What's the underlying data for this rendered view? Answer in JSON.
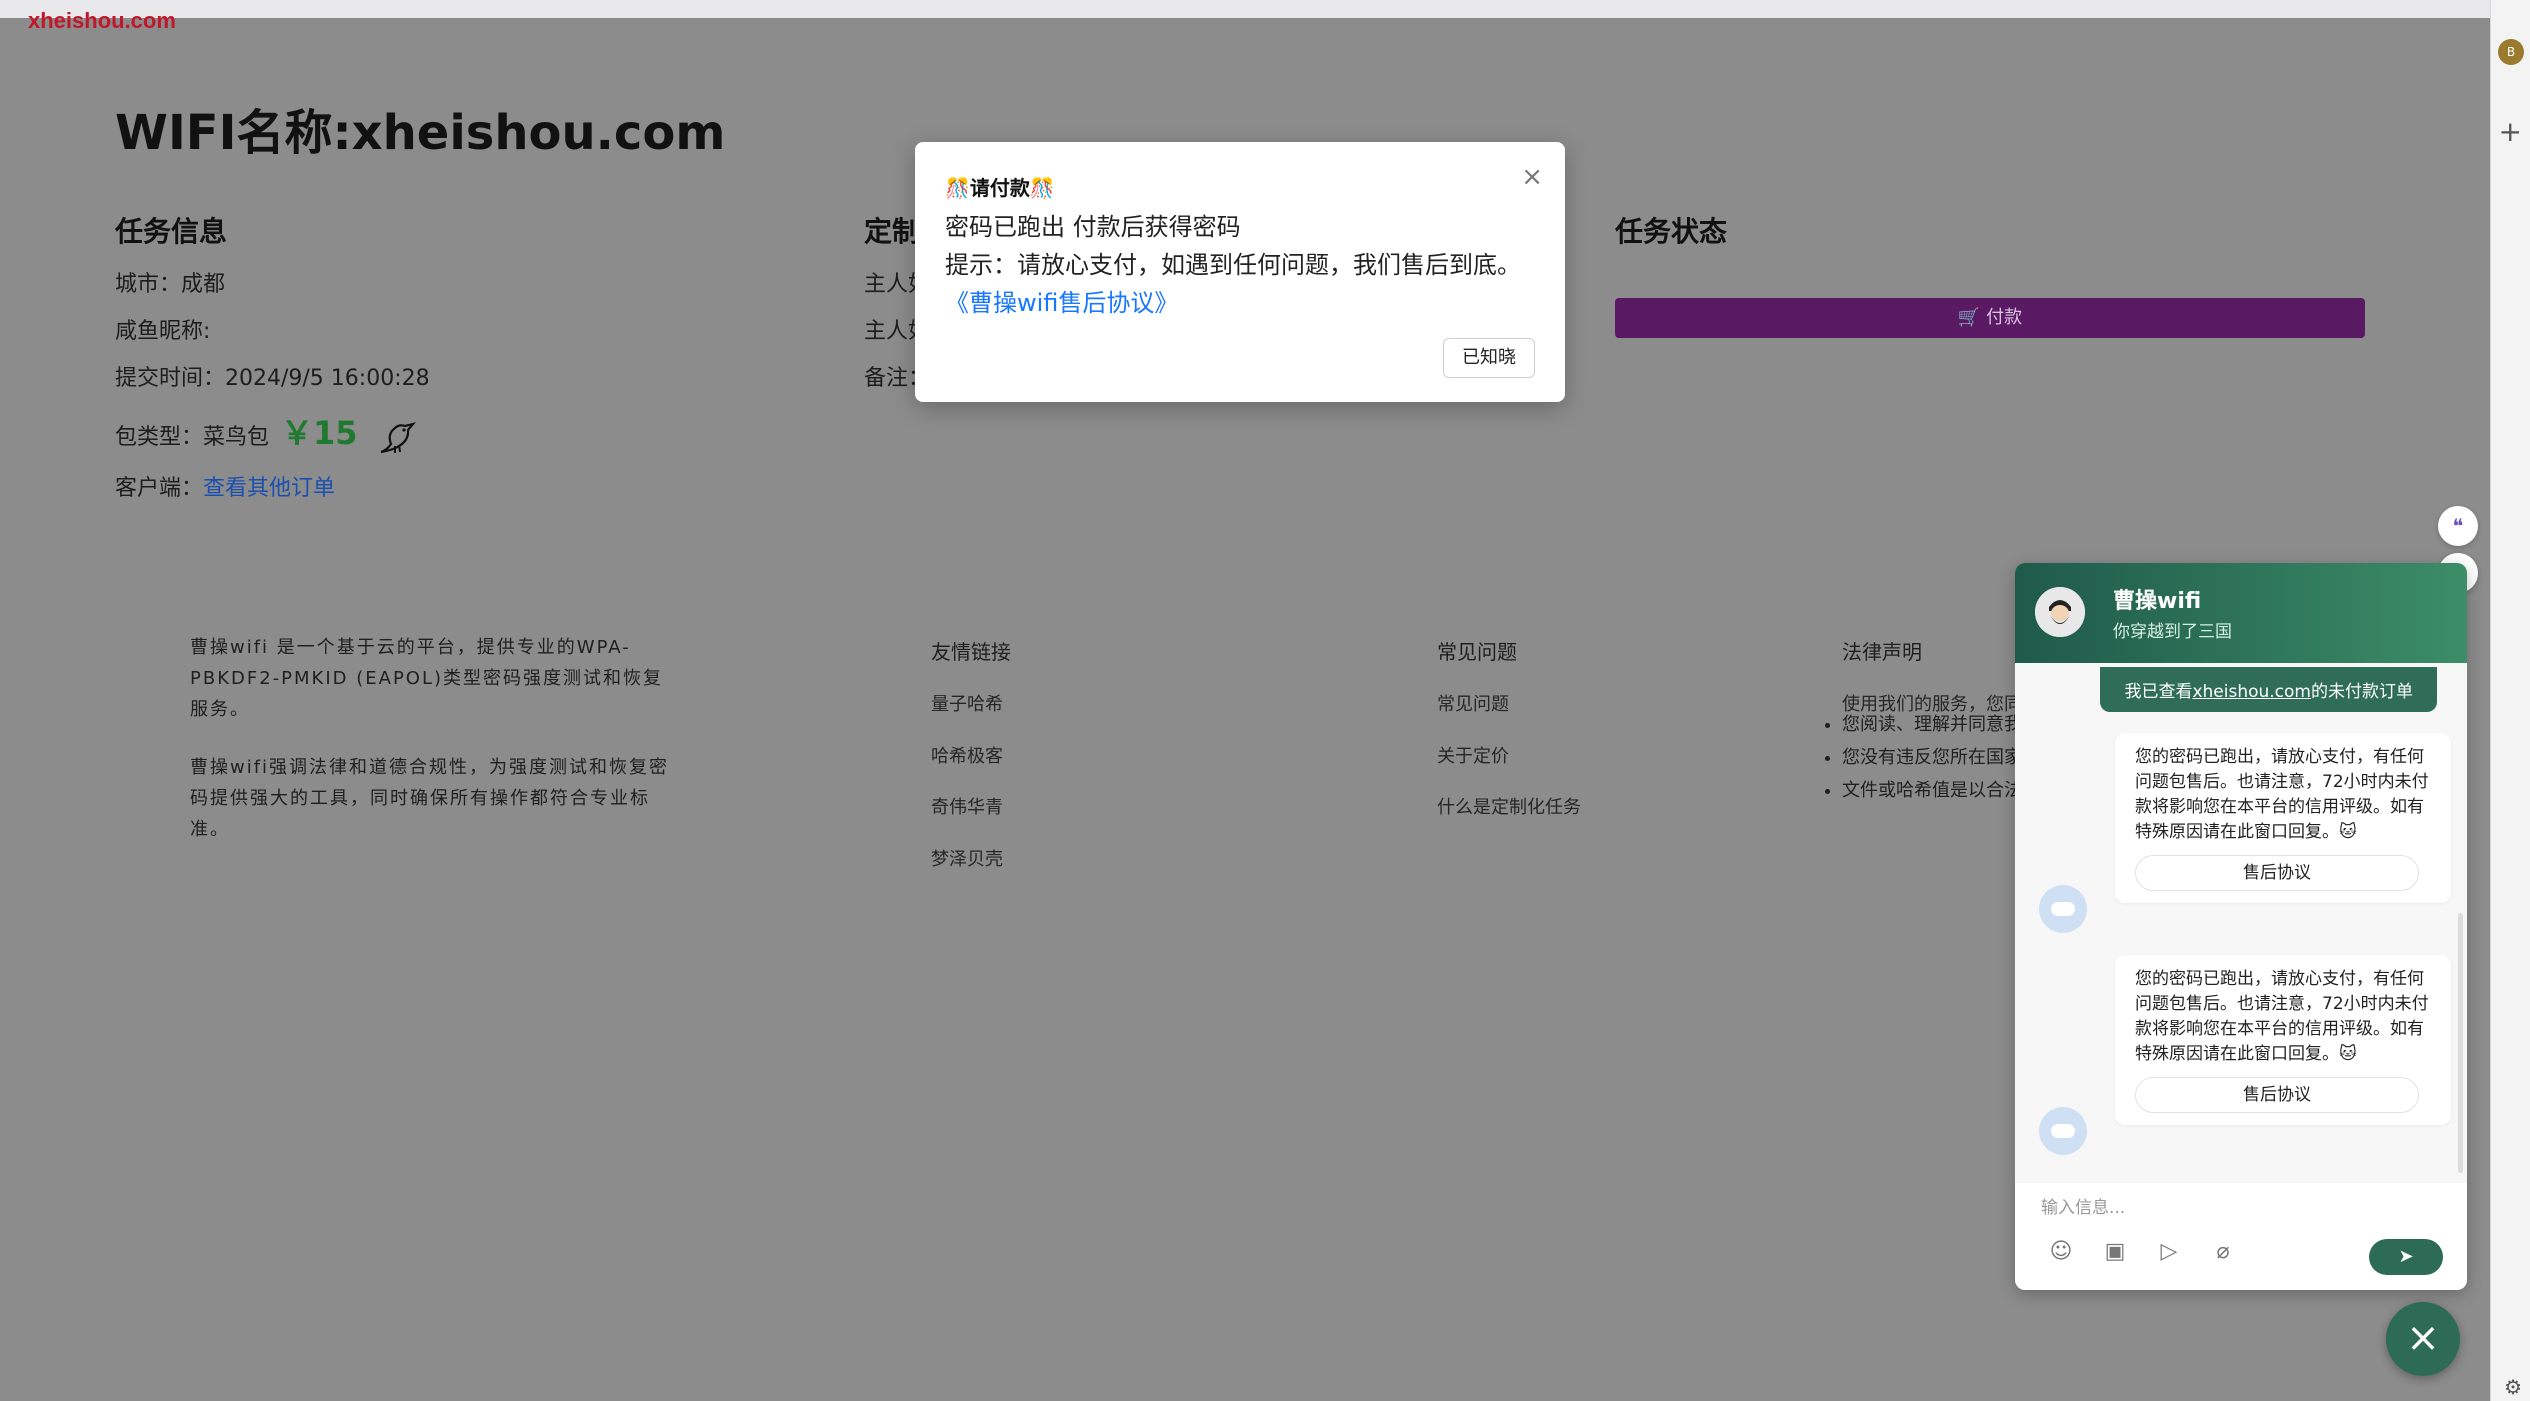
{
  "browser": {
    "brand": "xheishou.com",
    "avatar_letter": "B",
    "add_icon": "plus-icon",
    "settings_icon": "gear-icon"
  },
  "page": {
    "wifi_title": "WIFI名称:xheishou.com",
    "task_info": {
      "heading": "任务信息",
      "city": "城市：成都",
      "nickname": "咸鱼昵称:",
      "submit_time": "提交时间：2024/9/5 16:00:28",
      "package_label": "包类型：菜鸟包",
      "price": "￥15",
      "client_label": "客户端：",
      "client_link": "查看其他订单"
    },
    "custom": {
      "heading": "定制",
      "line1": "主人如",
      "line2": "主人如",
      "line3": "备注："
    },
    "task_status": {
      "heading": "任务状态",
      "pay_label": "付款"
    }
  },
  "footer": {
    "about_p1": "曹操wifi 是一个基于云的平台，提供专业的WPA-PBKDF2-PMKID (EAPOL)类型密码强度测试和恢复服务。",
    "about_p2": "曹操wifi强调法律和道德合规性，为强度测试和恢复密码提供强大的工具，同时确保所有操作都符合专业标准。",
    "links_heading": "友情链接",
    "links": [
      "量子哈希",
      "哈希极客",
      "奇伟华青",
      "梦泽贝壳"
    ],
    "faq_heading": "常见问题",
    "faq": [
      "常见问题",
      "关于定价",
      "什么是定制化任务"
    ],
    "legal_heading": "法律声明",
    "legal_intro": "使用我们的服务，您同",
    "legal_items": [
      "您阅读、理解并同意我",
      "您没有违反您所在国家",
      "文件或哈希值是以合法"
    ]
  },
  "modal": {
    "title": "🎊请付款🎊",
    "line1": "密码已跑出 付款后获得密码",
    "line2": "提示：请放心支付，如遇到任何问题，我们售后到底。",
    "link": "《曹操wifi售后协议》",
    "ack": "已知晓"
  },
  "chat": {
    "name": "曹操wifi",
    "subtitle": "你穿越到了三国",
    "user_msg_prefix": "我已查看",
    "user_msg_link": "xheishou.com",
    "user_msg_suffix": "的未付款订单",
    "bot_msg_1": "您的密码已跑出，请放心支付，有任何问题包售后。也请注意，72小时内未付款将影响您在本平台的信用评级。如有特殊原因请在此窗口回复。🐱",
    "bot_btn_1": "售后协议",
    "bot_msg_2": "您的密码已跑出，请放心支付，有任何问题包售后。也请注意，72小时内未付款将影响您在本平台的信用评级。如有特殊原因请在此窗口回复。🐱",
    "bot_btn_2": "售后协议",
    "input_placeholder": "输入信息..."
  }
}
